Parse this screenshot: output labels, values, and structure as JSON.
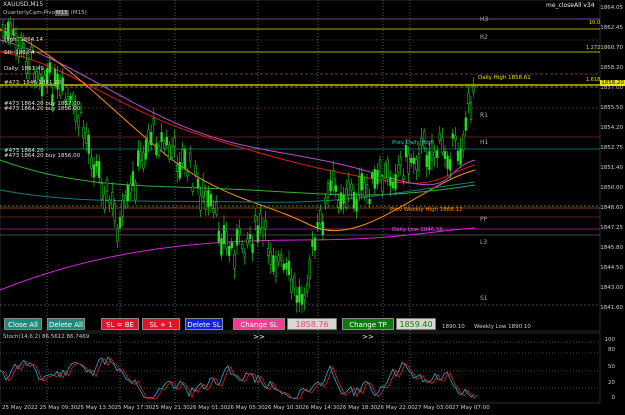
{
  "symbol_title": "XAUUSD,M15",
  "indicator_title": "QuarterlyCam-Pivots V2 (M15)",
  "ea_label": "me_closeAll v34",
  "toolbar": {
    "close_all": "Close All",
    "delete_all": "Delete All",
    "sl_be": "SL = BE",
    "sl_plus1": "SL + 1",
    "delete_sl": "Delete SL",
    "change_sl": "Change SL >>",
    "sl_value": "1858.76",
    "change_tp": "Change TP >>",
    "tp_value": "1859.40"
  },
  "colors": {
    "btn_green": "#1f8a7a",
    "btn_red": "#e8102a",
    "btn_blue": "#1020e8",
    "btn_pink": "#f43c8e",
    "btn_dkgreen": "#0e7a0e"
  },
  "pivot_labels": {
    "h3": "H3",
    "r2": "R2",
    "r1": "R1",
    "h1": "H1",
    "pp": "PP",
    "l3": "L3",
    "s1": "S1",
    "daily_high": "Daily High 1858.61",
    "prev_daily_high": "Prev Daily High",
    "prev_weekly_high": "Prev Weekly High 1868.12",
    "daily_low": "Daily Low 1846.56",
    "weekly_low": "Weekly Low 1890.10",
    "low_small": "1890.10"
  },
  "left_labels": {
    "high": "High: 1864.14",
    "sh": "SH: 1862.4",
    "line4": "Daily: 1861.49",
    "line5": "#473: 1846 1851.20",
    "line6": "#473 1864.20 buy 1857.00",
    "line7": "#473 1864.20 buy 1856.00",
    "line8": "#473 1864.20",
    "line9": "#473 1864.20 buy 1856.00"
  },
  "right_top": {
    "r3": "10.0",
    "r4": "1.272",
    "r5": "1.618"
  },
  "y_axis": [
    "1864.05",
    "1862.45",
    "1860.70",
    "1858.20",
    "1857.00",
    "1855.50",
    "1854.20",
    "1852.75",
    "1851.40",
    "1850.00",
    "1848.60",
    "1847.25",
    "1845.80",
    "1844.50",
    "1843.00",
    "1841.60"
  ],
  "current_price": "1858.20",
  "stoch_label": "Stoch(14,6,2) 86.5612 86.7469",
  "stoch_axis": [
    "100",
    "80",
    "50",
    "20",
    "0"
  ],
  "x_axis": [
    "25 May 2022",
    "25 May 09:30",
    "25 May 13:30",
    "25 May 17:30",
    "25 May 21:30",
    "26 May 01:30",
    "26 May 05:30",
    "26 May 10:30",
    "26 May 14:30",
    "26 May 18:30",
    "26 May 22:00",
    "27 May 03:00",
    "27 May 07:00"
  ]
}
